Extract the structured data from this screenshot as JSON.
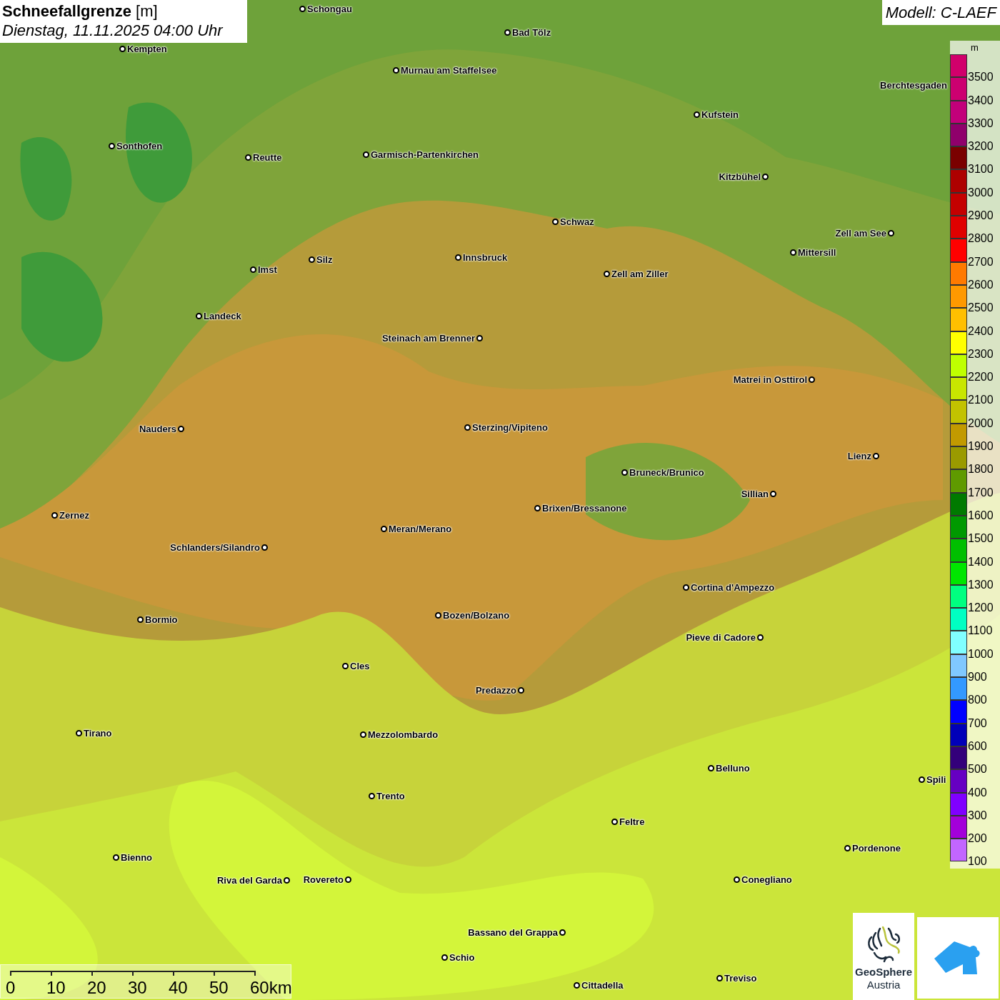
{
  "title": "**Schneefallgrenze** [m]",
  "subtitle": "Dienstag, 11.11.2025 04:00 Uhr",
  "model": "Modell: C-LAEF",
  "cities": [
    {
      "name": "Schongau"
    },
    {
      "name": "Bad Tölz"
    },
    {
      "name": "Kempten"
    },
    {
      "name": "Murnau am Staffelsee"
    },
    {
      "name": "Berchtesgaden"
    },
    {
      "name": "Kufstein"
    },
    {
      "name": "Sonthofen"
    },
    {
      "name": "Reutte"
    },
    {
      "name": "Garmisch-Partenkirchen"
    },
    {
      "name": "Kitzbühel"
    },
    {
      "name": "Schwaz"
    },
    {
      "name": "Zell am See"
    },
    {
      "name": "Innsbruck"
    },
    {
      "name": "Silz"
    },
    {
      "name": "Imst"
    },
    {
      "name": "Mittersill"
    },
    {
      "name": "Zell am Ziller"
    },
    {
      "name": "Landeck"
    },
    {
      "name": "Steinach am Brenner"
    },
    {
      "name": "Matrei in Osttirol"
    },
    {
      "name": "Nauders"
    },
    {
      "name": "Sterzing/Vipiteno"
    },
    {
      "name": "Lienz"
    },
    {
      "name": "Bruneck/Brunico"
    },
    {
      "name": "Sillian"
    },
    {
      "name": "Brixen/Bressanone"
    },
    {
      "name": "Zernez"
    },
    {
      "name": "Meran/Merano"
    },
    {
      "name": "Schlanders/Silandro"
    },
    {
      "name": "Cortina d'Ampezzo"
    },
    {
      "name": "Bozen/Bolzano"
    },
    {
      "name": "Bormio"
    },
    {
      "name": "Pieve di Cadore"
    },
    {
      "name": "Cles"
    },
    {
      "name": "Predazzo"
    },
    {
      "name": "Tirano"
    },
    {
      "name": "Mezzolombardo"
    },
    {
      "name": "Belluno"
    },
    {
      "name": "Spili"
    },
    {
      "name": "Trento"
    },
    {
      "name": "Feltre"
    },
    {
      "name": "Pordenone"
    },
    {
      "name": "Bienno"
    },
    {
      "name": "Riva del Garda"
    },
    {
      "name": "Rovereto"
    },
    {
      "name": "Conegliano"
    },
    {
      "name": "Bassano del Grappa"
    },
    {
      "name": "Schio"
    },
    {
      "name": "Treviso"
    },
    {
      "name": "Cittadella"
    }
  ],
  "legend": {
    "unit": "m",
    "items": [
      {
        "label": "3500",
        "color": "#d1006b"
      },
      {
        "label": "3400",
        "color": "#cc0070"
      },
      {
        "label": "3300",
        "color": "#c2007a"
      },
      {
        "label": "3200",
        "color": "#8f006b"
      },
      {
        "label": "3100",
        "color": "#7a0000"
      },
      {
        "label": "3000",
        "color": "#ad0000"
      },
      {
        "label": "2900",
        "color": "#c40000"
      },
      {
        "label": "2800",
        "color": "#e00000"
      },
      {
        "label": "2700",
        "color": "#ff0000"
      },
      {
        "label": "2600",
        "color": "#ff7a00"
      },
      {
        "label": "2500",
        "color": "#ff9900"
      },
      {
        "label": "2400",
        "color": "#ffbf00"
      },
      {
        "label": "2300",
        "color": "#ffff00"
      },
      {
        "label": "2200",
        "color": "#bfff00"
      },
      {
        "label": "2100",
        "color": "#c8e600"
      },
      {
        "label": "2000",
        "color": "#c2c200"
      },
      {
        "label": "1900",
        "color": "#c29a00"
      },
      {
        "label": "1800",
        "color": "#9a9a00"
      },
      {
        "label": "1700",
        "color": "#5f9a00"
      },
      {
        "label": "1600",
        "color": "#007a00"
      },
      {
        "label": "1500",
        "color": "#009900"
      },
      {
        "label": "1400",
        "color": "#00bf00"
      },
      {
        "label": "1300",
        "color": "#00e600"
      },
      {
        "label": "1200",
        "color": "#00ff80"
      },
      {
        "label": "1100",
        "color": "#00ffc2"
      },
      {
        "label": "1000",
        "color": "#80ffff"
      },
      {
        "label": "900",
        "color": "#80c8ff"
      },
      {
        "label": "800",
        "color": "#3399ff"
      },
      {
        "label": "700",
        "color": "#0000ff"
      },
      {
        "label": "600",
        "color": "#0000b8"
      },
      {
        "label": "500",
        "color": "#33007a"
      },
      {
        "label": "400",
        "color": "#6600c2"
      },
      {
        "label": "300",
        "color": "#8000ff"
      },
      {
        "label": "200",
        "color": "#a300d9"
      },
      {
        "label": "100",
        "color": "#c266ff"
      }
    ]
  },
  "scale_bar": {
    "labels": [
      "0",
      "10",
      "20",
      "30",
      "40",
      "50",
      "60km"
    ]
  },
  "logo": {
    "line1": "GeoSphere",
    "line2": "Austria"
  }
}
